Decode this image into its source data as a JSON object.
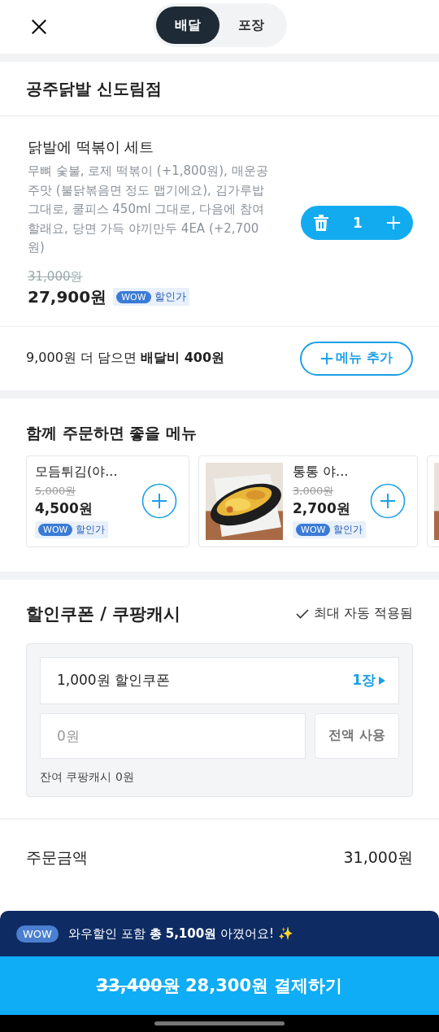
{
  "header": {
    "tabs": [
      {
        "label": "배달",
        "selected": true
      },
      {
        "label": "포장",
        "selected": false
      }
    ]
  },
  "store": {
    "name": "공주닭발 신도림점"
  },
  "cart_item": {
    "name": "닭발에 떡볶이 세트",
    "options": "무뼈 숯불, 로제 떡볶이 (+1,800원), 매운공주맛 (불닭볶음면 정도 맵기에요), 김가루밥 그대로, 쿨피스 450ml 그대로, 다음에 참여 할래요, 당면 가득 야끼만두 4EA (+2,700원)",
    "original_price": "31,000원",
    "price": "27,900원",
    "badge": {
      "wow": "WOW",
      "label": "할인가"
    },
    "quantity": "1"
  },
  "delivery_tip": {
    "text": "9,000원 더 담으면 **배달비 400원**",
    "button": "메뉴 추가"
  },
  "recommend": {
    "title": "함께 주문하면 좋을 메뉴",
    "items": [
      {
        "has_picture": false,
        "name": "모듬튀김(야...",
        "original_price": "5,000원",
        "price": "4,500원",
        "badge": {
          "wow": "WOW",
          "label": "할인가"
        }
      },
      {
        "has_picture": true,
        "name": "통통 야...",
        "original_price": "3,000원",
        "price": "2,700원",
        "badge": {
          "wow": "WOW",
          "label": "할인가"
        }
      },
      {
        "has_picture": true
      }
    ]
  },
  "coupon": {
    "title": "할인쿠폰 / 쿠팡캐시",
    "auto_note": "최대 자동 적용됨",
    "coupon_row": {
      "label": "1,000원 할인쿠폰",
      "count": "1장"
    },
    "cash_input": {
      "placeholder": "0원"
    },
    "use_all": "전액 사용",
    "balance": "잔여 쿠팡캐시 0원"
  },
  "summary": [
    {
      "label": "주문금액",
      "value": "31,000원"
    }
  ],
  "wow_banner": {
    "badge": "WOW",
    "text": "와우할인 포함 **총 5,100원** 아꼈어요! ✨"
  },
  "pay_button": {
    "original": "33,400원",
    "label": "28,300원 결제하기"
  }
}
